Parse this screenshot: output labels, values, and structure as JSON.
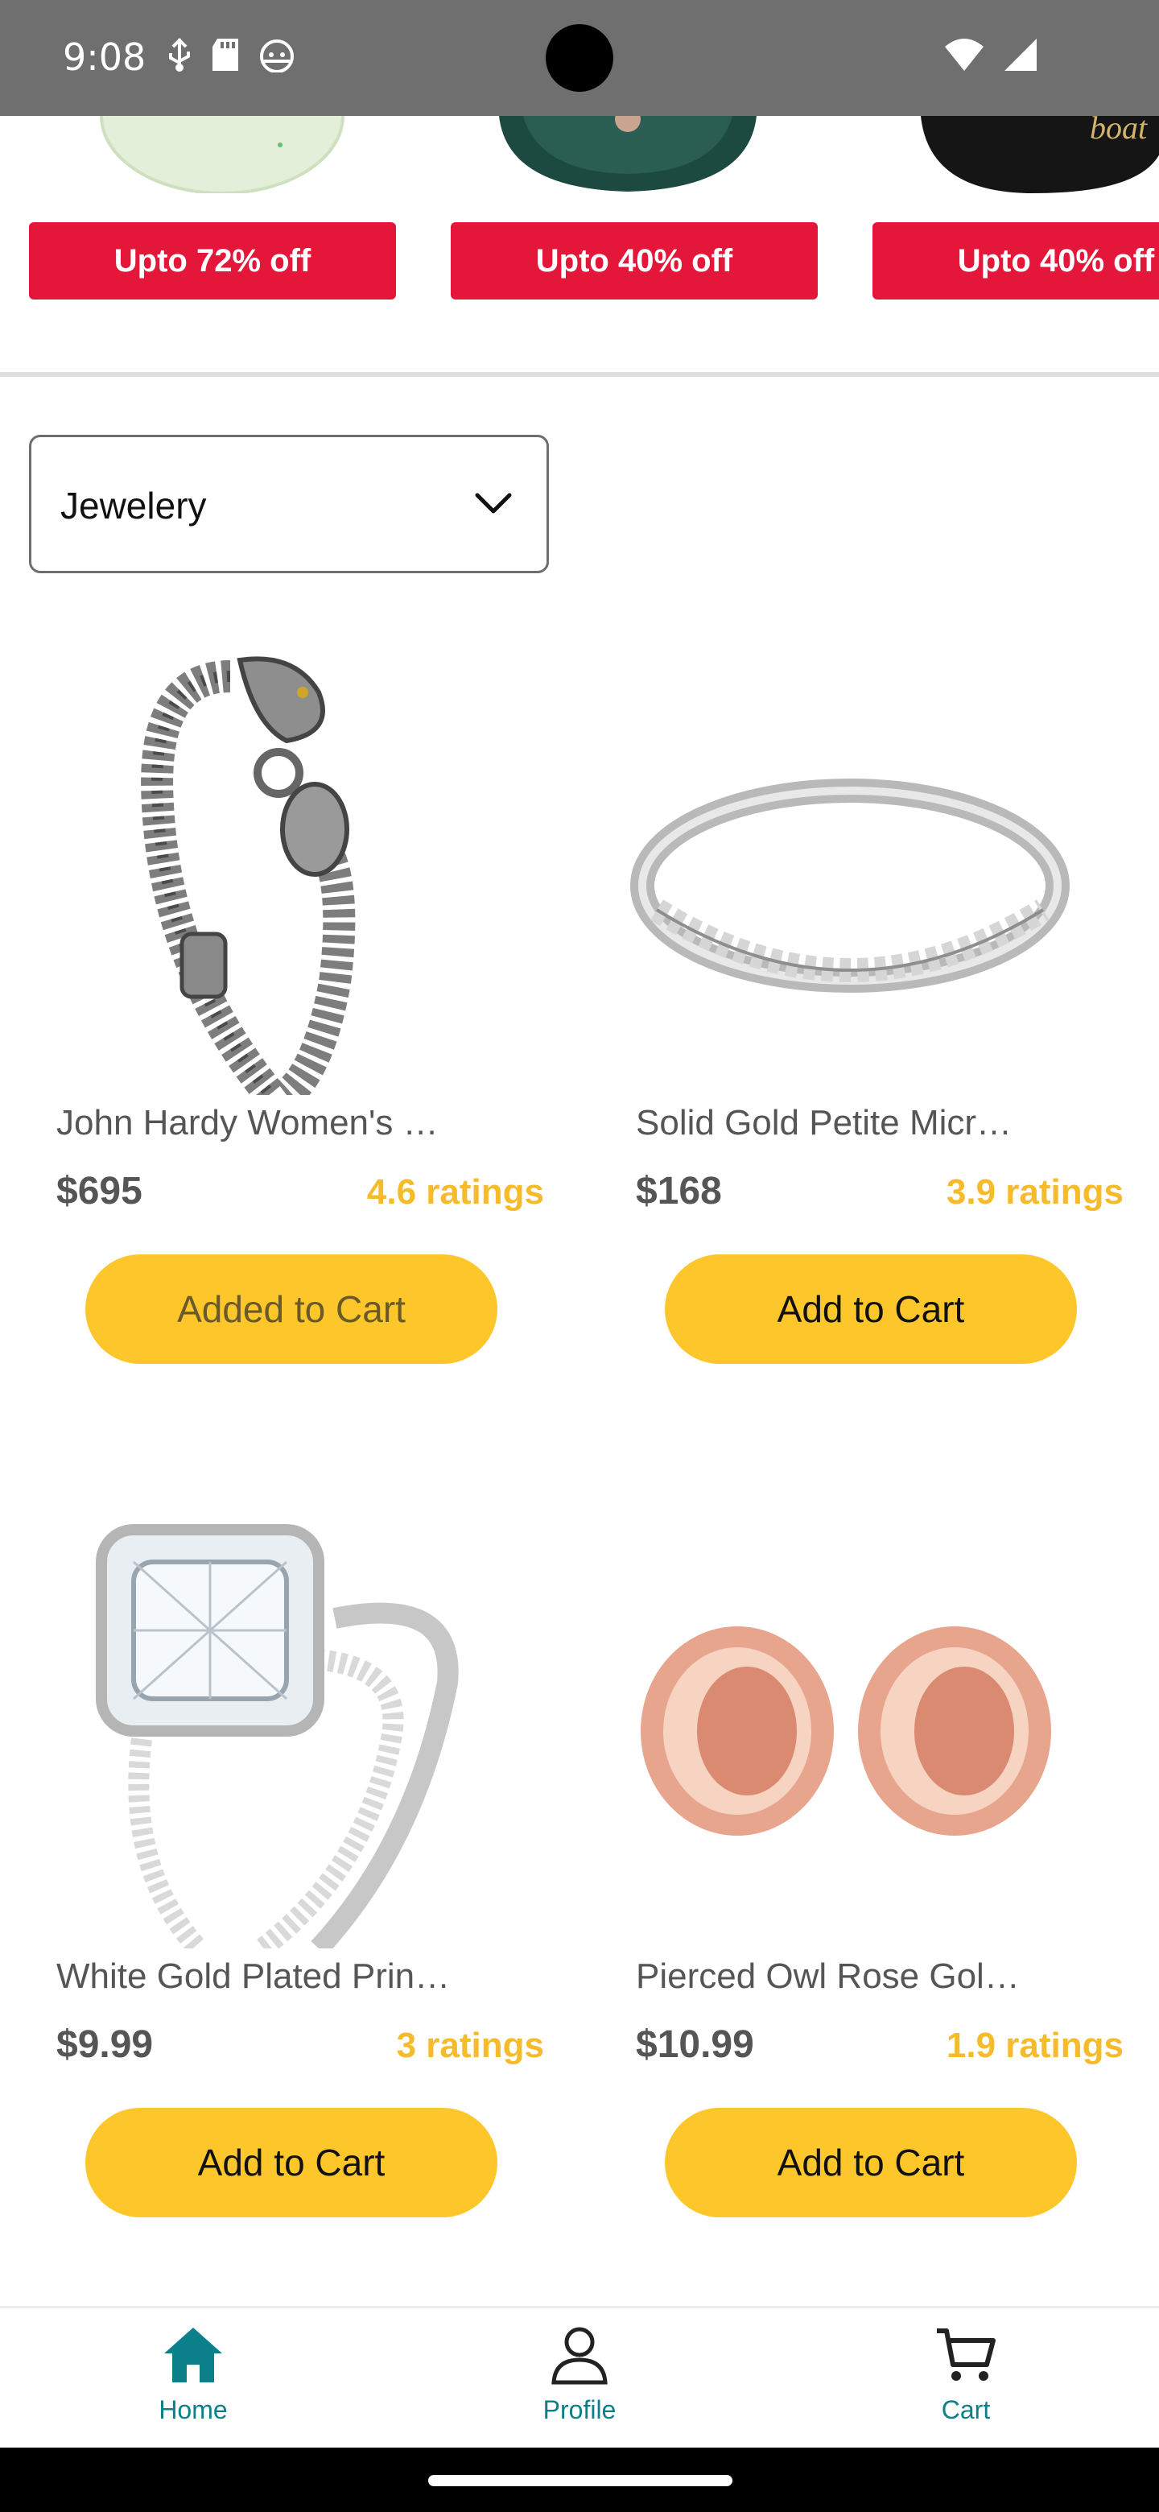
{
  "status_bar": {
    "time": "9:08",
    "left_icons": [
      "usb-debug-icon",
      "sd-card-icon",
      "android-icon"
    ],
    "right_icons": [
      "wifi-icon",
      "signal-icon"
    ]
  },
  "offers": [
    {
      "label": "Upto 72% off",
      "image": "earbuds-case-image"
    },
    {
      "label": "Upto 40% off",
      "image": "smartwatch-band-image"
    },
    {
      "label": "Upto 40% off",
      "image": "boat-earbuds-image"
    }
  ],
  "offer_logo_text": "boat",
  "category_dropdown": {
    "selected": "Jewelery",
    "icon": "chevron-down-icon"
  },
  "products": [
    {
      "title": "John Hardy Women's …",
      "price": "$695",
      "rating": "4.6 ratings",
      "button": "Added to Cart",
      "image": "chain-bracelet-image"
    },
    {
      "title": "Solid Gold Petite Micr…",
      "price": "$168",
      "rating": "3.9 ratings",
      "button": "Add to Cart",
      "image": "silver-ring-image"
    },
    {
      "title": "White Gold Plated Prin…",
      "price": "$9.99",
      "rating": "3 ratings",
      "button": "Add to Cart",
      "image": "diamond-ring-set-image"
    },
    {
      "title": "Pierced Owl Rose Gol…",
      "price": "$10.99",
      "rating": "1.9 ratings",
      "button": "Add to Cart",
      "image": "rose-gold-tunnels-image"
    }
  ],
  "bottom_nav": [
    {
      "label": "Home",
      "icon": "home-icon",
      "active": true
    },
    {
      "label": "Profile",
      "icon": "person-icon",
      "active": false
    },
    {
      "label": "Cart",
      "icon": "cart-icon",
      "active": false
    }
  ],
  "colors": {
    "offer_red": "#e4173b",
    "button_yellow": "#fdc62b",
    "rating_yellow": "#f5bb2a",
    "nav_teal": "#0b7f8a"
  }
}
